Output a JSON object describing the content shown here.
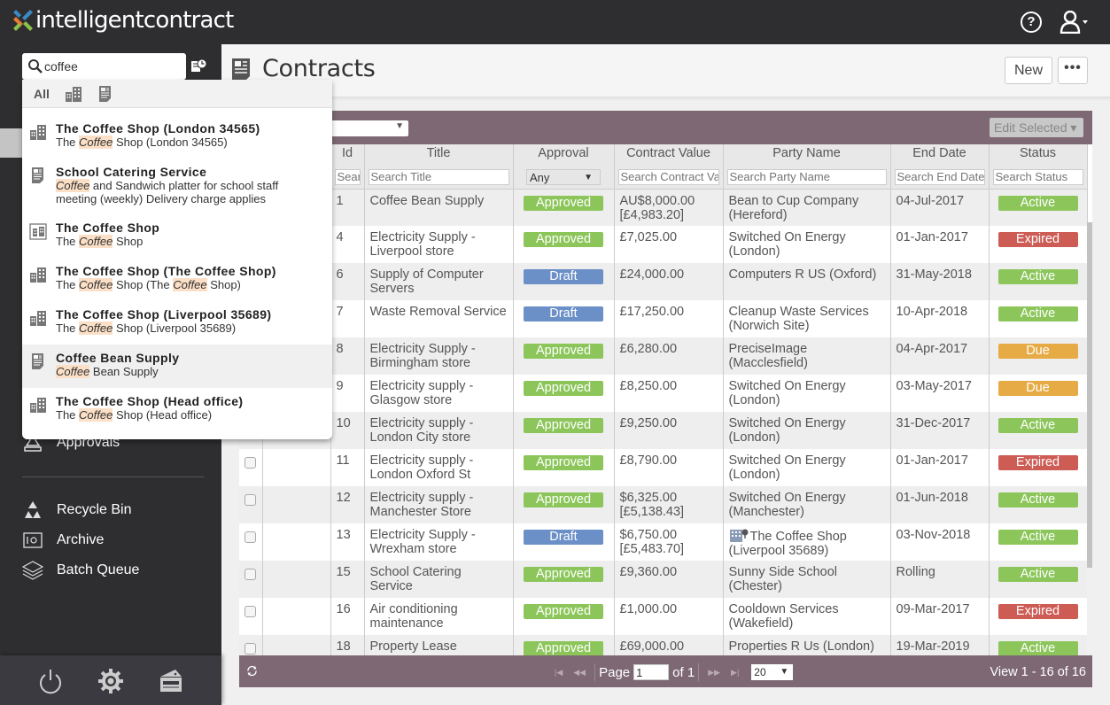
{
  "app": {
    "brand": "intelligentcontract",
    "help_icon": "help-icon",
    "user_icon": "user-icon"
  },
  "sidebar": {
    "search": {
      "value": "coffee",
      "placeholder": ""
    },
    "nav_items": [
      {
        "label": "Approvals",
        "icon": "approvals-stamp-icon"
      },
      {
        "label": "Recycle Bin",
        "icon": "recycle-icon"
      },
      {
        "label": "Archive",
        "icon": "archive-icon"
      },
      {
        "label": "Batch Queue",
        "icon": "layers-icon"
      }
    ],
    "footer_icons": [
      "power-icon",
      "settings-gear-icon",
      "ticket-icon"
    ]
  },
  "search_dropdown": {
    "tabs": {
      "all": "All",
      "icons": [
        "building-icon",
        "document-icon"
      ]
    },
    "highlight": "Coffee",
    "items": [
      {
        "title": "The Coffee Shop (London 34565)",
        "subtitle_parts": [
          "The ",
          "Coffee",
          " Shop (London 34565)"
        ],
        "icon": "building-icon"
      },
      {
        "title": "School Catering Service",
        "subtitle_parts": [
          "",
          "Coffee",
          " and Sandwich platter for school staff meeting (weekly) Delivery charge applies"
        ],
        "icon": "document-icon"
      },
      {
        "title": "The Coffee Shop",
        "subtitle_parts": [
          "The ",
          "Coffee",
          " Shop"
        ],
        "icon": "building-group-icon"
      },
      {
        "title": "The Coffee Shop (The Coffee Shop)",
        "subtitle_parts": [
          "The ",
          "Coffee",
          " Shop (The ",
          "Coffee",
          " Shop)"
        ],
        "icon": "building-icon"
      },
      {
        "title": "The Coffee Shop (Liverpool 35689)",
        "subtitle_parts": [
          "The ",
          "Coffee",
          " Shop (Liverpool 35689)"
        ],
        "icon": "building-icon"
      },
      {
        "title": "Coffee Bean Supply",
        "subtitle_parts": [
          "",
          "Coffee",
          " Bean Supply"
        ],
        "icon": "document-icon",
        "hovered": true
      },
      {
        "title": "The Coffee Shop (Head office)",
        "subtitle_parts": [
          "The ",
          "Coffee",
          " Shop (Head office)"
        ],
        "icon": "building-icon"
      }
    ]
  },
  "page": {
    "title": "Contracts",
    "new_label": "New",
    "more_label": "•••",
    "edit_selected_label": "Edit Selected ▾"
  },
  "grid": {
    "columns": [
      "",
      "",
      "Id",
      "Title",
      "Approval",
      "Contract Value",
      "Party Name",
      "End Date",
      "Status"
    ],
    "filters": {
      "id_placeholder": "Search Id",
      "title_placeholder": "Search Title",
      "approval_value": "Any",
      "value_placeholder": "Search Contract Value",
      "party_placeholder": "Search Party Name",
      "enddate_placeholder": "Search End Date",
      "status_placeholder": "Search Status"
    },
    "colors": {
      "Approved": "#8cc65b",
      "Draft": "#6b8fc7",
      "Active": "#8cc65b",
      "Expired": "#cd5c55",
      "Due": "#e6ab45"
    },
    "rows": [
      {
        "id": "1",
        "title": "Coffee Bean Supply",
        "approval": "Approved",
        "value": "AU$8,000.00 [£4,983.20]",
        "party": "Bean to Cup Company (Hereford)",
        "end_date": "04-Jul-2017",
        "status": "Active"
      },
      {
        "id": "4",
        "title": "Electricity Supply - Liverpool store",
        "approval": "Approved",
        "value": "£7,025.00",
        "party": "Switched On Energy (London)",
        "end_date": "01-Jan-2017",
        "status": "Expired"
      },
      {
        "id": "6",
        "title": "Supply of Computer Servers",
        "approval": "Draft",
        "value": "£24,000.00",
        "party": "Computers R US (Oxford)",
        "end_date": "31-May-2018",
        "status": "Active"
      },
      {
        "id": "7",
        "title": "Waste Removal Service",
        "approval": "Draft",
        "value": "£17,250.00",
        "party": "Cleanup Waste Services (Norwich Site)",
        "end_date": "10-Apr-2018",
        "status": "Active"
      },
      {
        "id": "8",
        "title": "Electricity Supply - Birmingham store",
        "approval": "Approved",
        "value": "£6,280.00",
        "party": "PreciseImage (Macclesfield)",
        "end_date": "04-Apr-2017",
        "status": "Due"
      },
      {
        "id": "9",
        "title": "Electricity supply - Glasgow store",
        "approval": "Approved",
        "value": "£8,250.00",
        "party": "Switched On Energy (London)",
        "end_date": "03-May-2017",
        "status": "Due"
      },
      {
        "id": "10",
        "title": "Electricity supply - London City store",
        "approval": "Approved",
        "value": "£9,250.00",
        "party": "Switched On Energy (London)",
        "end_date": "31-Dec-2017",
        "status": "Active"
      },
      {
        "id": "11",
        "title": "Electricity supply - London Oxford St",
        "approval": "Approved",
        "value": "£8,790.00",
        "party": "Switched On Energy (London)",
        "end_date": "01-Jan-2017",
        "status": "Expired"
      },
      {
        "id": "12",
        "title": "Electricity supply - Manchester Store",
        "approval": "Approved",
        "value": "$6,325.00 [£5,138.43]",
        "party": "Switched On Energy (Manchester)",
        "end_date": "01-Jun-2018",
        "status": "Active"
      },
      {
        "id": "13",
        "title": "Electricity Supply - Wrexham store",
        "approval": "Draft",
        "value": "$6,750.00 [£5,483.70]",
        "party": "The Coffee Shop (Liverpool 35689)",
        "party_icon": "building-info-icon",
        "end_date": "03-Nov-2018",
        "status": "Active"
      },
      {
        "id": "15",
        "title": "School Catering Service",
        "approval": "Approved",
        "value": "£9,360.00",
        "party": "Sunny Side School (Chester)",
        "end_date": "Rolling",
        "status": "Active"
      },
      {
        "id": "16",
        "title": "Air conditioning maintenance",
        "approval": "Approved",
        "value": "£1,000.00",
        "party": "Cooldown Services (Wakefield)",
        "end_date": "09-Mar-2017",
        "status": "Expired"
      },
      {
        "id": "18",
        "title": "Property Lease",
        "approval": "Approved",
        "value": "£69,000.00",
        "party": "Properties R Us (London)",
        "end_date": "19-Mar-2019",
        "status": "Active"
      }
    ],
    "pager": {
      "page_label": "Page",
      "page_value": "1",
      "of_label": "of 1",
      "page_size": "20",
      "view_info": "View 1 - 16 of 16"
    }
  }
}
